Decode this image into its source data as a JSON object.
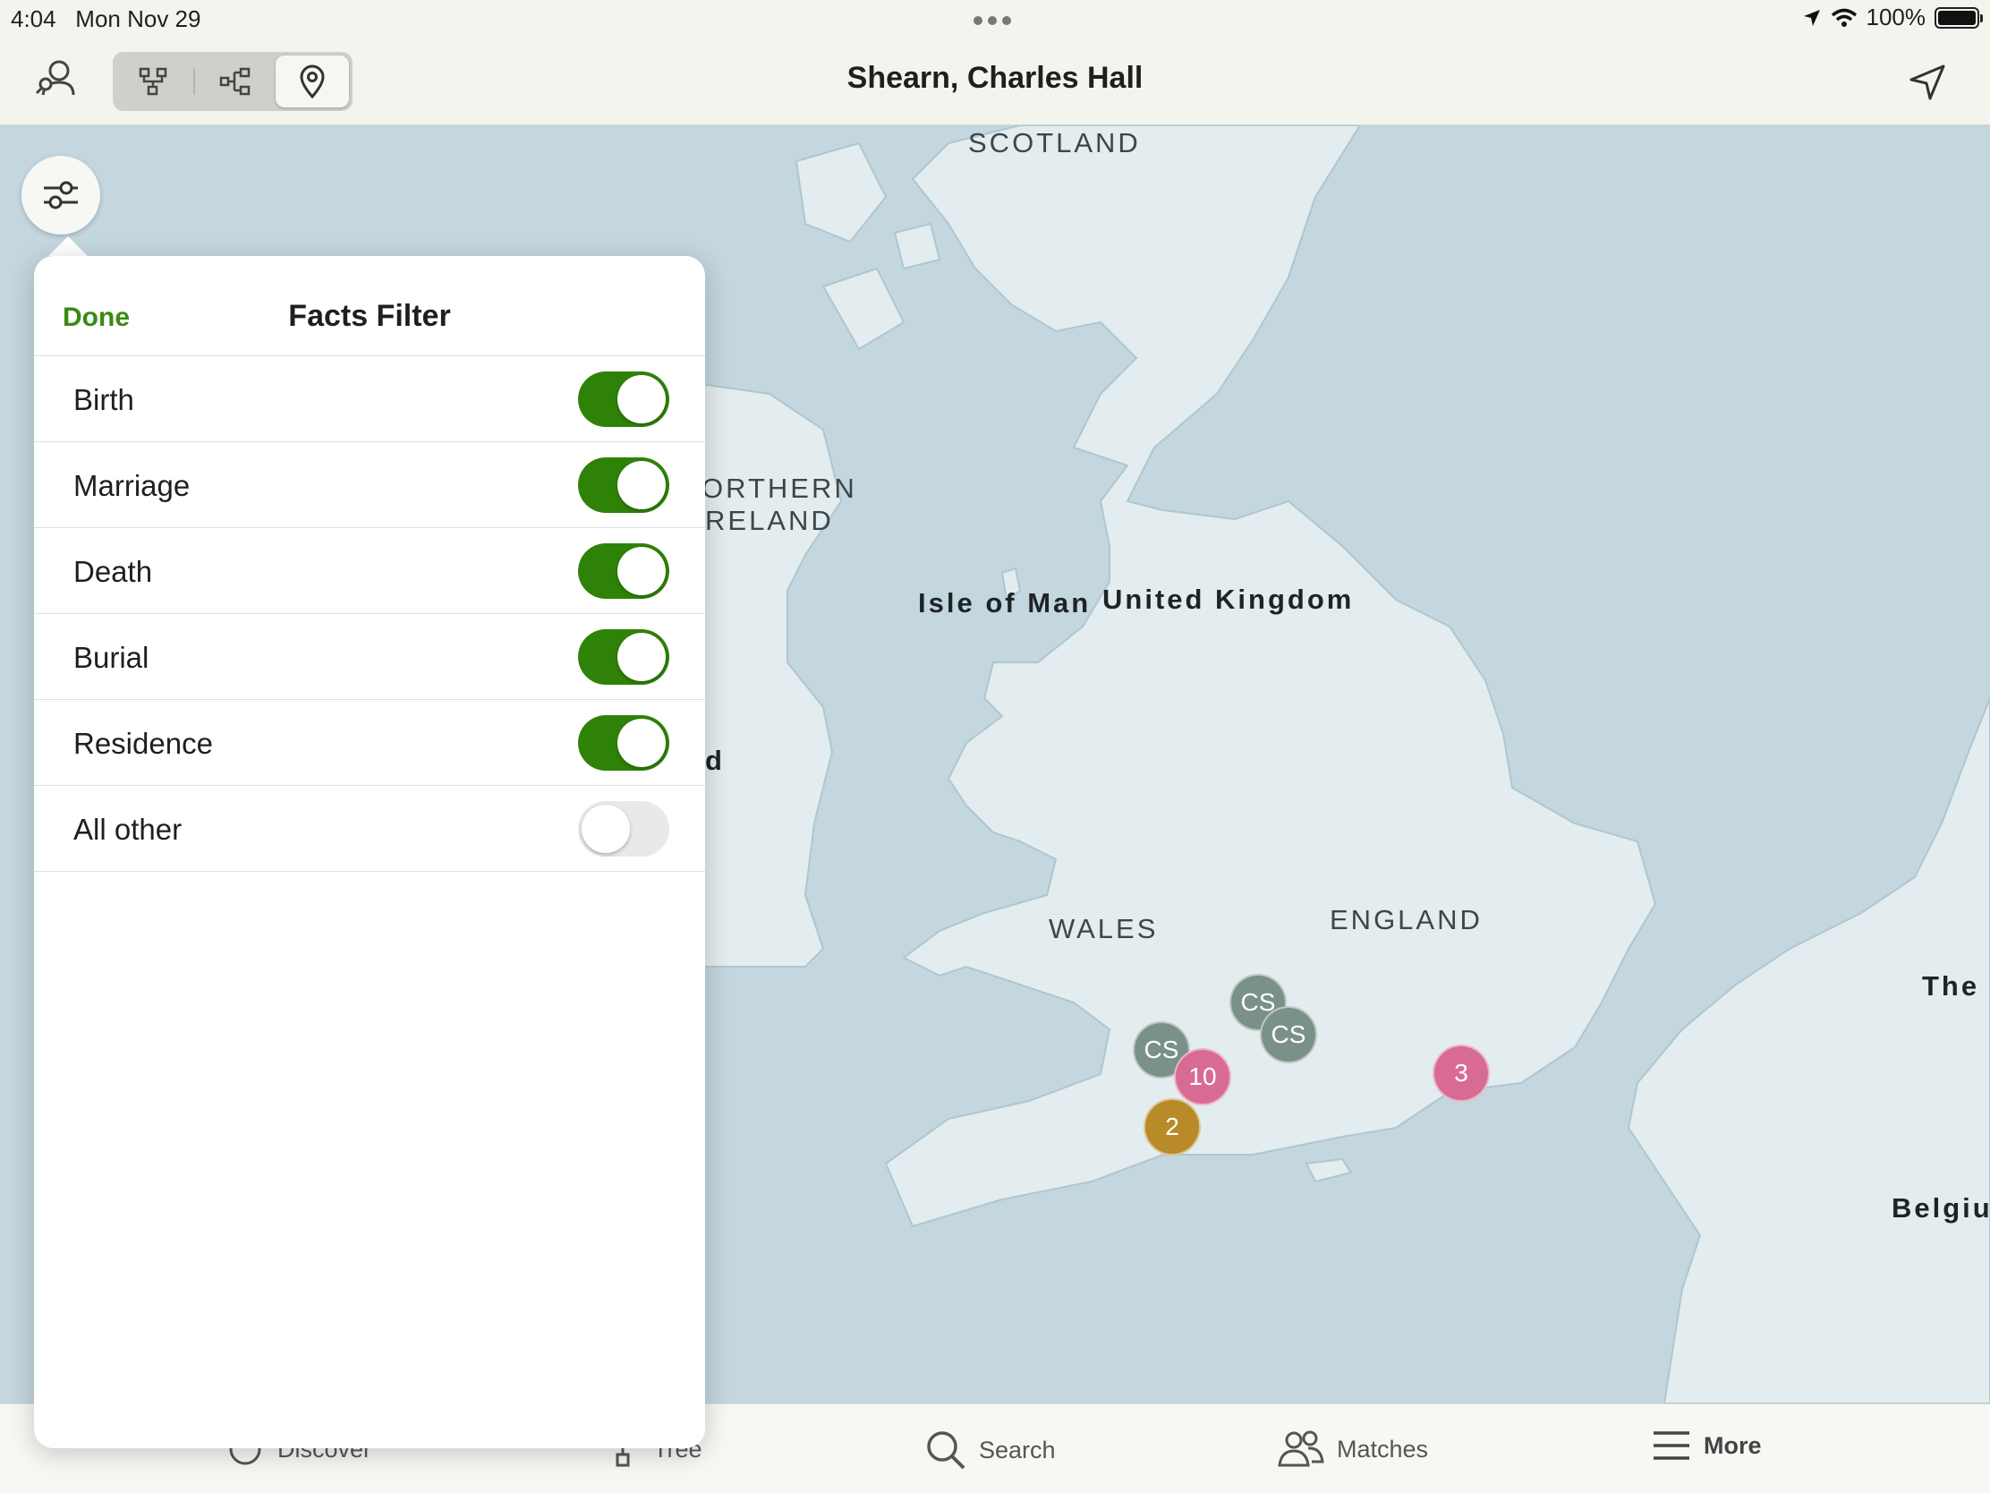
{
  "status_bar": {
    "time": "4:04",
    "date": "Mon Nov 29",
    "battery": "100%"
  },
  "nav": {
    "title": "Shearn, Charles Hall",
    "view_modes": [
      {
        "name": "pedigree-view",
        "active": false
      },
      {
        "name": "family-view",
        "active": false
      },
      {
        "name": "map-view",
        "active": true
      }
    ]
  },
  "filter_popover": {
    "done_label": "Done",
    "title": "Facts Filter",
    "rows": [
      {
        "label": "Birth",
        "on": true
      },
      {
        "label": "Marriage",
        "on": true
      },
      {
        "label": "Death",
        "on": true
      },
      {
        "label": "Burial",
        "on": true
      },
      {
        "label": "Residence",
        "on": true
      },
      {
        "label": "All other",
        "on": false
      }
    ]
  },
  "map": {
    "labels": {
      "scotland": "SCOTLAND",
      "northern_ireland_1": "ORTHERN",
      "northern_ireland_2": "RELAND",
      "isle_of_man": "Isle of Man",
      "united_kingdom": "United Kingdom",
      "ireland_fragment": "d",
      "wales": "WALES",
      "england": "ENGLAND",
      "netherlands_fragment": "The",
      "belgium_fragment": "Belgiu"
    },
    "markers": [
      {
        "text": "CS",
        "color": "#7a9188"
      },
      {
        "text": "CS",
        "color": "#7a9188"
      },
      {
        "text": "CS",
        "color": "#7a9188"
      },
      {
        "text": "10",
        "color": "#d86b93"
      },
      {
        "text": "3",
        "color": "#d86b93"
      },
      {
        "text": "2",
        "color": "#b88a28"
      }
    ]
  },
  "tabs": [
    {
      "label": "Discover",
      "active": false
    },
    {
      "label": "Tree",
      "active": false
    },
    {
      "label": "Search",
      "active": false
    },
    {
      "label": "Matches",
      "active": false
    },
    {
      "label": "More",
      "active": true
    }
  ],
  "colors": {
    "accent_green": "#2f8208",
    "done_green": "#3a8a12"
  }
}
